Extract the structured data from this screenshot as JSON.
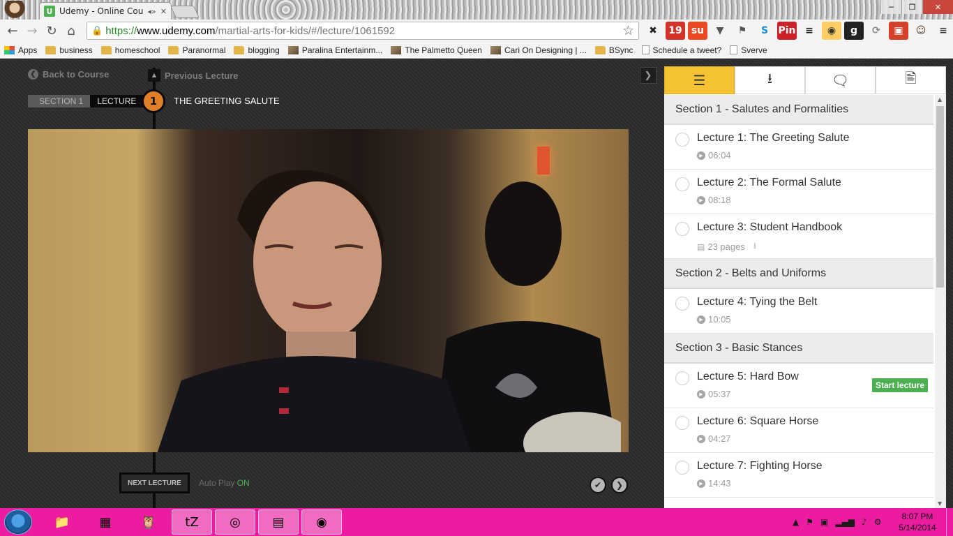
{
  "browser": {
    "tab_title": "Udemy - Online Courses",
    "tab_favicon": "U",
    "audio_glyph": "◂»",
    "close_glyph": "✕",
    "url": {
      "scheme": "https://",
      "host": "www.udemy.com",
      "path": "/martial-arts-for-kids/#/lecture/1061592"
    },
    "window_controls": [
      "─",
      "❐",
      "✕"
    ],
    "nav": {
      "back": "←",
      "forward": "→",
      "reload": "↻",
      "home": "⌂"
    },
    "star_glyph": "☆",
    "extensions": [
      {
        "name": "x-extension-icon",
        "glyph": "✖",
        "color": "#222222",
        "bg": "transparent"
      },
      {
        "name": "todoist-icon",
        "glyph": "19",
        "color": "#ffffff",
        "bg": "#d3322b"
      },
      {
        "name": "stumbleupon-icon",
        "glyph": "su",
        "color": "#ffffff",
        "bg": "#eb4924"
      },
      {
        "name": "pocket-icon",
        "glyph": "▼",
        "color": "#555555",
        "bg": "transparent"
      },
      {
        "name": "evernote-icon",
        "glyph": "⚑",
        "color": "#555555",
        "bg": "transparent"
      },
      {
        "name": "skype-icon",
        "glyph": "S",
        "color": "#1a8fd8",
        "bg": "transparent"
      },
      {
        "name": "pinterest-icon",
        "glyph": "Pin",
        "color": "#ffffff",
        "bg": "#cb2027"
      },
      {
        "name": "buffer-icon",
        "glyph": "≡",
        "color": "#222222",
        "bg": "transparent"
      },
      {
        "name": "hootsuite-icon",
        "glyph": "◉",
        "color": "#333333",
        "bg": "#ffcc66"
      },
      {
        "name": "goodreads-icon",
        "glyph": "g",
        "color": "#ffffff",
        "bg": "#222222"
      },
      {
        "name": "refresh-extension-icon",
        "glyph": "⟳",
        "color": "#888888",
        "bg": "transparent"
      },
      {
        "name": "card-extension-icon",
        "glyph": "▣",
        "color": "#ffffff",
        "bg": "#d5402b"
      },
      {
        "name": "avatar-extension-icon",
        "glyph": "☺",
        "color": "#5a3b26",
        "bg": "transparent"
      },
      {
        "name": "chrome-menu-icon",
        "glyph": "≡",
        "color": "#444444",
        "bg": "transparent"
      }
    ],
    "bookmarks": [
      {
        "label": "Apps",
        "icon": "apps"
      },
      {
        "label": "business",
        "icon": "folder"
      },
      {
        "label": "homeschool",
        "icon": "folder"
      },
      {
        "label": "Paranormal",
        "icon": "folder"
      },
      {
        "label": "blogging",
        "icon": "folder"
      },
      {
        "label": "Paralina Entertainm...",
        "icon": "img"
      },
      {
        "label": "The Palmetto Queen",
        "icon": "img"
      },
      {
        "label": "Cari On Designing | ...",
        "icon": "img"
      },
      {
        "label": "BSync",
        "icon": "folder"
      },
      {
        "label": "Schedule a tweet?",
        "icon": "page"
      },
      {
        "label": "Sverve",
        "icon": "page"
      }
    ]
  },
  "player": {
    "back_to_course": "Back to Course",
    "previous_lecture": "Previous Lecture",
    "section_crumb": "SECTION 1",
    "lecture_crumb": "LECTURE",
    "lecture_number": "1",
    "lecture_title": "THE GREETING SALUTE",
    "next_lecture": "NEXT LECTURE",
    "autoplay_label": "Auto Play",
    "autoplay_state": "ON",
    "complete_glyph": "✔",
    "next_glyph": "❯",
    "collapse_glyph": "❯"
  },
  "sidebar": {
    "tabs": [
      {
        "name": "curriculum-tab",
        "glyph": "☰",
        "active": true
      },
      {
        "name": "downloads-tab",
        "glyph": "⭳",
        "active": false
      },
      {
        "name": "discussion-tab",
        "glyph": "🗨",
        "active": false
      },
      {
        "name": "notes-tab",
        "glyph": "🖹",
        "active": false
      }
    ],
    "sections": [
      {
        "title": "Section 1 - Salutes and Formalities",
        "lectures": [
          {
            "title": "Lecture 1: The Greeting Salute",
            "type": "video",
            "meta": "06:04"
          },
          {
            "title": "Lecture 2: The Formal Salute",
            "type": "video",
            "meta": "08:18"
          },
          {
            "title": "Lecture 3: Student Handbook",
            "type": "doc",
            "meta": "23 pages"
          }
        ]
      },
      {
        "title": "Section 2 - Belts and Uniforms",
        "lectures": [
          {
            "title": "Lecture 4: Tying the Belt",
            "type": "video",
            "meta": "10:05"
          }
        ]
      },
      {
        "title": "Section 3 - Basic Stances",
        "lectures": [
          {
            "title": "Lecture 5: Hard Bow",
            "type": "video",
            "meta": "05:37",
            "action": "Start lecture"
          },
          {
            "title": "Lecture 6: Square Horse",
            "type": "video",
            "meta": "04:27"
          },
          {
            "title": "Lecture 7: Fighting Horse",
            "type": "video",
            "meta": "14:43"
          }
        ]
      }
    ]
  },
  "taskbar": {
    "apps": [
      {
        "name": "file-explorer-icon",
        "glyph": "📁",
        "active": false
      },
      {
        "name": "metro-apps-icon",
        "glyph": "▦",
        "active": false
      },
      {
        "name": "owl-app-icon",
        "glyph": "🦉",
        "active": false
      },
      {
        "name": "tz-app-icon",
        "glyph": "tZ",
        "active": true
      },
      {
        "name": "chrome-icon",
        "glyph": "◎",
        "active": true
      },
      {
        "name": "sticky-notes-icon",
        "glyph": "▤",
        "active": true
      },
      {
        "name": "photo-app-icon",
        "glyph": "◉",
        "active": true
      }
    ],
    "tray": [
      "▲",
      "⚑",
      "▣",
      "▂▄▆",
      "♪",
      "⚙"
    ],
    "time": "8:07 PM",
    "date": "5/14/2014"
  }
}
